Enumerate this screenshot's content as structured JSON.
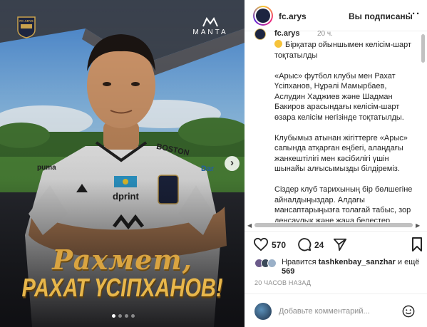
{
  "media": {
    "club_crest_icon": "fc-arys-crest",
    "sponsor_logo_text": "MANTA",
    "script_title": "Рахмет,",
    "player_name": "РАХАТ ҮСІПХАНОВ!",
    "carousel_dots": 4,
    "active_dot": 1,
    "kit_text": {
      "sponsor_main": "dprint",
      "sponsor_shoulder": "BOSTON",
      "sleeve_right": "Dar",
      "collar_left": "puma"
    }
  },
  "header": {
    "username": "fc.arys",
    "follow_status": "Вы подписаны",
    "more_icon": "more-horizontal-icon"
  },
  "caption": {
    "username": "fc.arys",
    "time": "20 ч.",
    "paragraphs": [
      "Бірқатар ойыншымен келісім-шарт тоқтатылды",
      "«Арыс» футбол клубы мен Рахат Үсіпханов, Нұрәлі Мамырбаев, Аслудин Хаджиев және Шадман Бакиров арасындағы келісім-шарт өзара келісім негізінде тоқтатылды.",
      "Клубымыз атынан жігіттерге «Арыс» сапында атқарған еңбегі, алаңдағы жанкештілігі мен кәсібилігі үшін шынайы алғысымызды білдіреміз.",
      "Сіздер клуб тарихының бір бөлшегіне айналдыңыздар. Алдағы мансаптарыңызға толағай табыс, зор денсаулық және жаңа белестер тілейміз!"
    ]
  },
  "actions": {
    "like_icon": "heart-icon",
    "like_count": "570",
    "comment_icon": "comment-bubble-icon",
    "comment_count": "24",
    "share_icon": "paper-plane-icon",
    "save_icon": "bookmark-icon"
  },
  "likes": {
    "prefix": "Нравится",
    "user": "tashkenbay_sanzhar",
    "and_more": "и ещё",
    "more_count": "569"
  },
  "timestamp": "20 ЧАСОВ НАЗАД",
  "comment": {
    "placeholder": "Добавьте комментарий...",
    "emoji_icon": "smiley-icon"
  },
  "colors": {
    "accent_gold": "#e8b74b",
    "kit_navy": "#1d2540",
    "text": "#262626",
    "muted": "#8e8e8e"
  }
}
